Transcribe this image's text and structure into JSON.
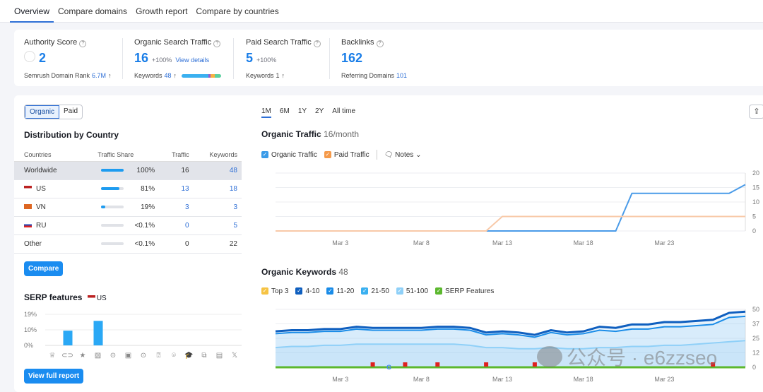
{
  "tabs": [
    "Overview",
    "Compare domains",
    "Growth report",
    "Compare by countries"
  ],
  "summary": {
    "authority": {
      "title": "Authority Score",
      "value": "2",
      "sub_label": "Semrush Domain Rank",
      "sub_value": "6.7M"
    },
    "organic": {
      "title": "Organic Search Traffic",
      "value": "16",
      "change": "+100%",
      "link": "View details",
      "sub_label": "Keywords",
      "sub_value": "48"
    },
    "paid": {
      "title": "Paid Search Traffic",
      "value": "5",
      "change": "+100%",
      "sub_label": "Keywords",
      "sub_value": "1"
    },
    "backlinks": {
      "title": "Backlinks",
      "value": "162",
      "sub_label": "Referring Domains",
      "sub_value": "101"
    }
  },
  "left": {
    "toggle": [
      "Organic",
      "Paid"
    ],
    "dist_title": "Distribution by Country",
    "columns": [
      "Countries",
      "Traffic Share",
      "Traffic",
      "Keywords"
    ],
    "rows": [
      {
        "country": "Worldwide",
        "share": "100%",
        "share_pct": 100,
        "traffic": "16",
        "keywords": "48",
        "flag": ""
      },
      {
        "country": "US",
        "share": "81%",
        "share_pct": 81,
        "traffic": "13",
        "keywords": "18",
        "flag": "us"
      },
      {
        "country": "VN",
        "share": "19%",
        "share_pct": 19,
        "traffic": "3",
        "keywords": "3",
        "flag": "vn"
      },
      {
        "country": "RU",
        "share": "<0.1%",
        "share_pct": 0,
        "traffic": "0",
        "keywords": "5",
        "flag": "ru"
      },
      {
        "country": "Other",
        "share": "<0.1%",
        "share_pct": 0,
        "traffic": "0",
        "keywords": "22",
        "flag": ""
      }
    ],
    "compare_btn": "Compare",
    "serp_title": "SERP features",
    "serp_country": "US",
    "serp_ticks": [
      "19%",
      "10%",
      "0%"
    ],
    "serp_values": [
      0,
      9,
      0,
      15,
      0,
      0,
      0,
      0,
      0,
      0,
      0,
      0,
      0
    ],
    "serp_icons": [
      "crown-icon",
      "link-icon",
      "star-icon",
      "image-icon",
      "video-icon",
      "play-icon",
      "video-carousel-icon",
      "faq-icon",
      "location-icon",
      "education-icon",
      "document-icon",
      "briefcase-icon",
      "x-icon"
    ],
    "serp_glyphs": [
      "♕",
      "⊂⊃",
      "★",
      "▨",
      "⊙",
      "▣",
      "⊙",
      "⍰",
      "⌾",
      "🎓",
      "⧉",
      "▤",
      "𝕏"
    ],
    "full_report_btn": "View full report"
  },
  "right": {
    "periods": [
      "1M",
      "6M",
      "1Y",
      "2Y",
      "All time"
    ],
    "traffic_title": "Organic Traffic",
    "traffic_sub": "16/month",
    "traffic_legend": [
      "Organic Traffic",
      "Paid Traffic"
    ],
    "notes": "Notes",
    "kw_title": "Organic Keywords",
    "kw_sub": "48",
    "kw_legend": [
      {
        "label": "Top 3",
        "color": "#f6c343"
      },
      {
        "label": "4-10",
        "color": "#0f5fbf"
      },
      {
        "label": "11-20",
        "color": "#1a8ce8"
      },
      {
        "label": "21-50",
        "color": "#3ab0f0"
      },
      {
        "label": "51-100",
        "color": "#8fd0f8"
      },
      {
        "label": "SERP Features",
        "color": "#5cb82e"
      }
    ]
  },
  "chart_data": [
    {
      "type": "line",
      "title": "Organic Traffic",
      "x": [
        "Feb 27",
        "Feb 28",
        "Mar 1",
        "Mar 2",
        "Mar 3",
        "Mar 4",
        "Mar 5",
        "Mar 6",
        "Mar 7",
        "Mar 8",
        "Mar 9",
        "Mar 10",
        "Mar 11",
        "Mar 12",
        "Mar 13",
        "Mar 14",
        "Mar 15",
        "Mar 16",
        "Mar 17",
        "Mar 18",
        "Mar 19",
        "Mar 20",
        "Mar 21",
        "Mar 22",
        "Mar 23",
        "Mar 24",
        "Mar 25",
        "Mar 26",
        "Mar 27",
        "Mar 28"
      ],
      "xticks": [
        "Mar 3",
        "Mar 8",
        "Mar 13",
        "Mar 18",
        "Mar 23"
      ],
      "yticks": [
        "20",
        "15",
        "10",
        "5",
        "0"
      ],
      "ylim": [
        0,
        20
      ],
      "series": [
        {
          "name": "Organic Traffic",
          "color": "#4a9be8",
          "values": [
            0,
            0,
            0,
            0,
            0,
            0,
            0,
            0,
            0,
            0,
            0,
            0,
            0,
            0,
            0,
            0,
            0,
            0,
            0,
            0,
            0,
            0,
            13,
            13,
            13,
            13,
            13,
            13,
            13,
            16
          ]
        },
        {
          "name": "Paid Traffic",
          "color": "#f8c9a8",
          "values": [
            0,
            0,
            0,
            0,
            0,
            0,
            0,
            0,
            0,
            0,
            0,
            0,
            0,
            0,
            5,
            5,
            5,
            5,
            5,
            5,
            5,
            5,
            5,
            5,
            5,
            5,
            5,
            5,
            5,
            5
          ]
        }
      ]
    },
    {
      "type": "area",
      "title": "Organic Keywords",
      "x": [
        "Feb 27",
        "Feb 28",
        "Mar 1",
        "Mar 2",
        "Mar 3",
        "Mar 4",
        "Mar 5",
        "Mar 6",
        "Mar 7",
        "Mar 8",
        "Mar 9",
        "Mar 10",
        "Mar 11",
        "Mar 12",
        "Mar 13",
        "Mar 14",
        "Mar 15",
        "Mar 16",
        "Mar 17",
        "Mar 18",
        "Mar 19",
        "Mar 20",
        "Mar 21",
        "Mar 22",
        "Mar 23",
        "Mar 24",
        "Mar 25",
        "Mar 26",
        "Mar 27",
        "Mar 28"
      ],
      "xticks": [
        "Mar 3",
        "Mar 8",
        "Mar 13",
        "Mar 18",
        "Mar 23"
      ],
      "yticks": [
        "50",
        "37",
        "25",
        "12",
        "0"
      ],
      "ylim": [
        0,
        50
      ],
      "series": [
        {
          "name": "4-10",
          "color": "#0f5fbf",
          "values": [
            31,
            32,
            32,
            33,
            33,
            35,
            34,
            34,
            34,
            34,
            35,
            35,
            34,
            30,
            31,
            30,
            28,
            32,
            30,
            31,
            35,
            34,
            37,
            37,
            39,
            39,
            40,
            41,
            47,
            48
          ]
        },
        {
          "name": "11-20",
          "color": "#1a8ce8",
          "values": [
            29,
            30,
            30,
            31,
            31,
            33,
            32,
            32,
            32,
            32,
            33,
            33,
            32,
            28,
            29,
            28,
            26,
            30,
            28,
            29,
            32,
            31,
            33,
            33,
            35,
            35,
            36,
            37,
            43,
            44
          ]
        },
        {
          "name": "21-50",
          "color": "#8fd0f8",
          "values": [
            17,
            18,
            18,
            19,
            19,
            20,
            20,
            20,
            20,
            20,
            20,
            20,
            19,
            17,
            17,
            16,
            16,
            17,
            16,
            16,
            17,
            17,
            18,
            18,
            19,
            19,
            20,
            21,
            22,
            23
          ]
        }
      ],
      "flags": [
        "Mar 5",
        "Mar 7",
        "Mar 9",
        "Mar 12",
        "Mar 15",
        "Mar 26"
      ]
    }
  ]
}
